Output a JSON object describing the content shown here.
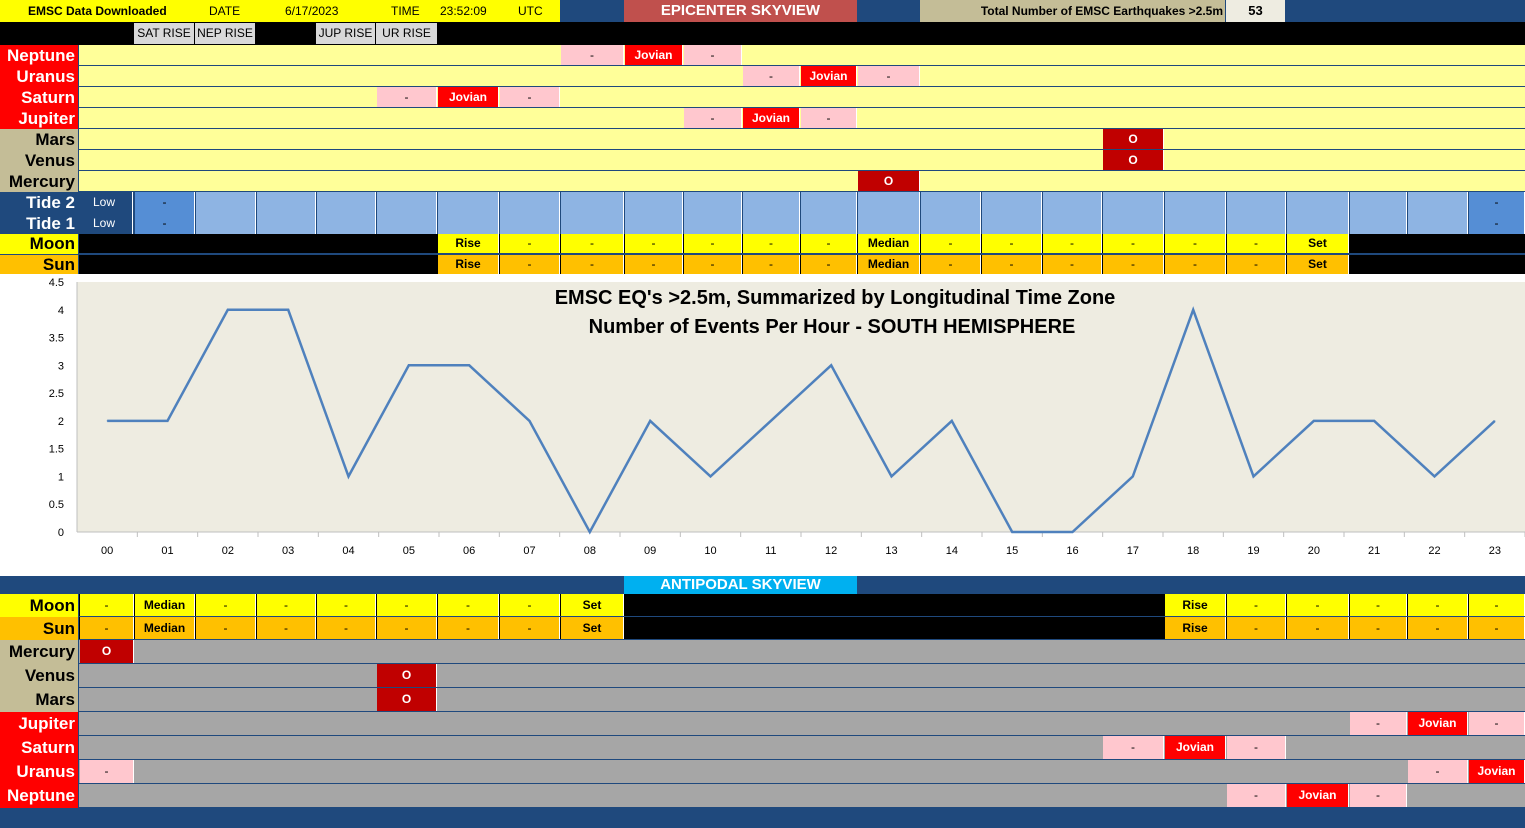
{
  "header": {
    "download_label": "EMSC Data Downloaded",
    "date_label": "DATE",
    "date_value": "6/17/2023",
    "time_label": "TIME",
    "time_value": "23:52:09",
    "tz": "UTC",
    "epicenter_title": "EPICENTER SKYVIEW",
    "total_label": "Total Number of EMSC Earthquakes >2.5m",
    "total_value": "53"
  },
  "rise_labels": {
    "sat": "SAT RISE",
    "nep": "NEP RISE",
    "jup": "JUP RISE",
    "ur": "UR RISE"
  },
  "colors": {
    "navy": "#1f497d",
    "yellow_bg": "#ffff99",
    "pink": "#ffc7ce",
    "red": "#ff0000",
    "dark_red": "#c00000",
    "tan": "#c4bd97",
    "tide_blue": "#8eb4e3",
    "tide_dark": "#558ed5",
    "moon_yellow": "#ffff00",
    "sun_orange": "#ffc000",
    "grey": "#a6a6a6",
    "title_red": "#c0504d",
    "antipodal_blue": "#00b0f0",
    "line": "#4f81bd",
    "plot_bg": "#eeece1"
  },
  "epicenter": {
    "planets": [
      {
        "name": "Neptune",
        "label_color": "red",
        "cells": [
          [
            8,
            "-",
            "pink"
          ],
          [
            9,
            "Jovian",
            "red"
          ],
          [
            10,
            "-",
            "pink"
          ]
        ]
      },
      {
        "name": "Uranus",
        "label_color": "red",
        "cells": [
          [
            11,
            "-",
            "pink"
          ],
          [
            12,
            "Jovian",
            "red"
          ],
          [
            13,
            "-",
            "pink"
          ]
        ]
      },
      {
        "name": "Saturn",
        "label_color": "red",
        "cells": [
          [
            5,
            "-",
            "pink"
          ],
          [
            6,
            "Jovian",
            "red"
          ],
          [
            7,
            "-",
            "pink"
          ]
        ]
      },
      {
        "name": "Jupiter",
        "label_color": "red",
        "cells": [
          [
            10,
            "-",
            "pink"
          ],
          [
            11,
            "Jovian",
            "red"
          ],
          [
            12,
            "-",
            "pink"
          ]
        ]
      },
      {
        "name": "Mars",
        "label_color": "tan",
        "cells": [
          [
            17,
            "O",
            "dark_red"
          ]
        ]
      },
      {
        "name": "Venus",
        "label_color": "tan",
        "cells": [
          [
            17,
            "O",
            "dark_red"
          ]
        ]
      },
      {
        "name": "Mercury",
        "label_color": "tan",
        "cells": [
          [
            13,
            "O",
            "dark_red"
          ]
        ]
      }
    ],
    "tides": [
      {
        "name": "Tide 2",
        "first": "Low",
        "cells": [
          [
            1,
            "-"
          ],
          [
            24,
            "-"
          ]
        ]
      },
      {
        "name": "Tide 1",
        "first": "Low",
        "cells": [
          [
            1,
            "-"
          ],
          [
            24,
            "-"
          ]
        ]
      }
    ],
    "moon": {
      "name": "Moon",
      "start": 6,
      "end": 21,
      "values": [
        "Rise",
        "-",
        "-",
        "-",
        "-",
        "-",
        "-",
        "Median",
        "-",
        "-",
        "-",
        "-",
        "-",
        "-",
        "Set"
      ]
    },
    "sun": {
      "name": "Sun",
      "start": 6,
      "end": 21,
      "values": [
        "Rise",
        "-",
        "-",
        "-",
        "-",
        "-",
        "-",
        "Median",
        "-",
        "-",
        "-",
        "-",
        "-",
        "-",
        "Set"
      ]
    }
  },
  "chart_data": {
    "type": "line",
    "title": "EMSC EQ's >2.5m, Summarized by Longitudinal Time Zone",
    "subtitle": "Number of Events Per Hour - SOUTH HEMISPHERE",
    "categories": [
      "00",
      "01",
      "02",
      "03",
      "04",
      "05",
      "06",
      "07",
      "08",
      "09",
      "10",
      "11",
      "12",
      "13",
      "14",
      "15",
      "16",
      "17",
      "18",
      "19",
      "20",
      "21",
      "22",
      "23"
    ],
    "values": [
      2,
      2,
      4,
      4,
      1,
      3,
      3,
      2,
      0,
      2,
      1,
      2,
      3,
      1,
      2,
      0,
      0,
      1,
      4,
      1,
      2,
      2,
      1,
      2
    ],
    "ylim": [
      0,
      4.5
    ],
    "yticks": [
      "0",
      "0.5",
      "1",
      "1.5",
      "2",
      "2.5",
      "3",
      "3.5",
      "4",
      "4.5"
    ],
    "grid": false,
    "legend": "none"
  },
  "antipodal": {
    "title": "ANTIPODAL SKYVIEW",
    "moon": {
      "name": "Moon",
      "cells": [
        [
          0,
          "-"
        ],
        [
          1,
          "Median"
        ],
        [
          2,
          "-"
        ],
        [
          3,
          "-"
        ],
        [
          4,
          "-"
        ],
        [
          5,
          "-"
        ],
        [
          6,
          "-"
        ],
        [
          7,
          "-"
        ],
        [
          8,
          "Set"
        ],
        [
          18,
          "Rise"
        ],
        [
          19,
          "-"
        ],
        [
          20,
          "-"
        ],
        [
          21,
          "-"
        ],
        [
          22,
          "-"
        ],
        [
          23,
          "-"
        ]
      ]
    },
    "sun": {
      "name": "Sun",
      "cells": [
        [
          0,
          "-"
        ],
        [
          1,
          "Median"
        ],
        [
          2,
          "-"
        ],
        [
          3,
          "-"
        ],
        [
          4,
          "-"
        ],
        [
          5,
          "-"
        ],
        [
          6,
          "-"
        ],
        [
          7,
          "-"
        ],
        [
          8,
          "Set"
        ],
        [
          18,
          "Rise"
        ],
        [
          19,
          "-"
        ],
        [
          20,
          "-"
        ],
        [
          21,
          "-"
        ],
        [
          22,
          "-"
        ],
        [
          23,
          "-"
        ]
      ]
    },
    "planets": [
      {
        "name": "Mercury",
        "label_color": "tan",
        "cells": [
          [
            0,
            "O",
            "dark_red"
          ]
        ]
      },
      {
        "name": "Venus",
        "label_color": "tan",
        "cells": [
          [
            5,
            "O",
            "dark_red"
          ]
        ]
      },
      {
        "name": "Mars",
        "label_color": "tan",
        "cells": [
          [
            5,
            "O",
            "dark_red"
          ]
        ]
      },
      {
        "name": "Jupiter",
        "label_color": "red",
        "cells": [
          [
            21,
            "-",
            "pink"
          ],
          [
            22,
            "Jovian",
            "red"
          ],
          [
            23,
            "-",
            "pink"
          ]
        ]
      },
      {
        "name": "Saturn",
        "label_color": "red",
        "cells": [
          [
            17,
            "-",
            "pink"
          ],
          [
            18,
            "Jovian",
            "red"
          ],
          [
            19,
            "-",
            "pink"
          ]
        ]
      },
      {
        "name": "Uranus",
        "label_color": "red",
        "cells": [
          [
            0,
            "-",
            "pink"
          ],
          [
            22,
            "-",
            "pink"
          ],
          [
            23,
            "Jovian",
            "red"
          ]
        ]
      },
      {
        "name": "Neptune",
        "label_color": "red",
        "cells": [
          [
            19,
            "-",
            "pink"
          ],
          [
            20,
            "Jovian",
            "red"
          ],
          [
            21,
            "-",
            "pink"
          ]
        ]
      }
    ]
  }
}
